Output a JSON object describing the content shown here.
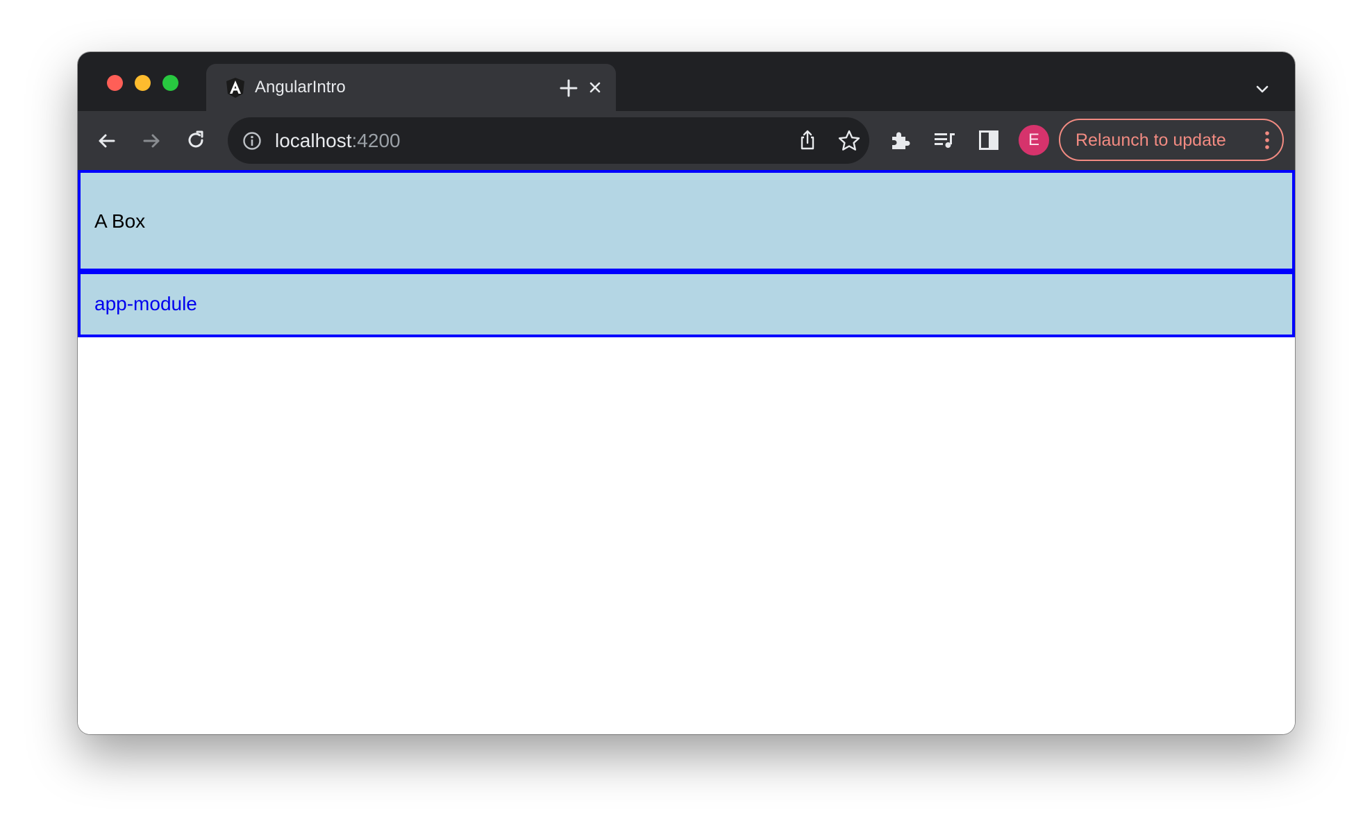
{
  "browser": {
    "tab": {
      "title": "AngularIntro",
      "favicon": "angular-logo-icon"
    },
    "address_bar": {
      "host": "localhost",
      "port": ":4200"
    },
    "relaunch_button": {
      "label": "Relaunch to update"
    },
    "profile": {
      "initial": "E",
      "color": "#d6336c"
    },
    "icons": [
      "back-arrow-icon",
      "forward-arrow-icon",
      "reload-icon",
      "info-icon",
      "share-icon",
      "star-icon",
      "extensions-puzzle-icon",
      "media-queue-icon",
      "side-panel-icon",
      "more-vert-icon",
      "close-icon",
      "plus-icon",
      "chevron-down-icon"
    ]
  },
  "page": {
    "box_a": {
      "text": "A Box"
    },
    "box_b": {
      "text": "app-module"
    },
    "colors": {
      "box_background": "#b4d6e4",
      "box_border": "#0000ff",
      "link_text": "#0000ee"
    }
  }
}
